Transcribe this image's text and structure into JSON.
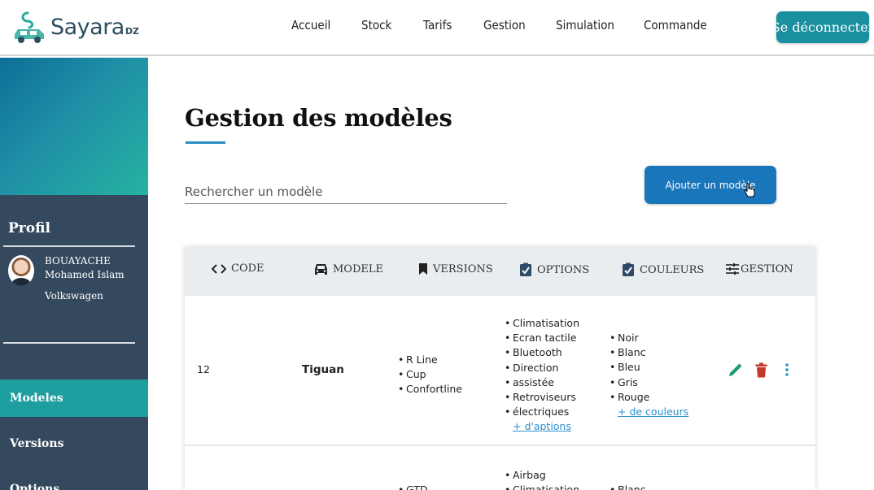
{
  "brand": {
    "name": "Sayara",
    "suffix": "DZ",
    "colors": {
      "primary": "#1a8fa0",
      "dark": "#2d4e5f",
      "accent": "#1a76bb"
    }
  },
  "nav": {
    "items": [
      "Accueil",
      "Stock",
      "Tarifs",
      "Gestion",
      "Simulation",
      "Commande"
    ],
    "logout": "Se déconnecter"
  },
  "sidebar": {
    "profile_title": "Profil",
    "profile": {
      "last_name": "BOUAYACHE",
      "first_name": "Mohamed Islam",
      "brand": "Volkswagen"
    },
    "items": [
      {
        "label": "Modeles",
        "active": true
      },
      {
        "label": "Versions",
        "active": false
      },
      {
        "label": "Options",
        "active": false
      }
    ]
  },
  "main": {
    "title": "Gestion des modèles",
    "search_placeholder": "Rechercher un modèle",
    "add_button": "Ajouter un modèle"
  },
  "table": {
    "headers": [
      {
        "label": "CODE",
        "icon": "code-icon"
      },
      {
        "label": "MODELE",
        "icon": "car-icon"
      },
      {
        "label": "VERSIONS",
        "icon": "bookmark-icon"
      },
      {
        "label": "OPTIONS",
        "icon": "clipboard-check-icon"
      },
      {
        "label": "COULEURS",
        "icon": "clipboard-check-icon"
      },
      {
        "label": "GESTION",
        "icon": "sliders-icon"
      }
    ],
    "rows": [
      {
        "code": "12",
        "modele": "Tiguan",
        "versions": [
          "R Line",
          "Cup",
          "Confortline"
        ],
        "options": [
          "Climatisation",
          "Ecran tactile",
          "Bluetooth",
          "Direction",
          "assistée",
          "Retroviseurs",
          "électriques"
        ],
        "options_more": "+ d'aptions",
        "couleurs": [
          "Noir",
          "Blanc",
          "Bleu",
          "Gris",
          "Rouge"
        ],
        "couleurs_more": "+ de couleurs"
      },
      {
        "code": "",
        "modele": "",
        "versions": [
          "GTD"
        ],
        "options": [
          "Airbag",
          "Climatisation"
        ],
        "couleurs": [
          "Blanc"
        ]
      }
    ]
  }
}
